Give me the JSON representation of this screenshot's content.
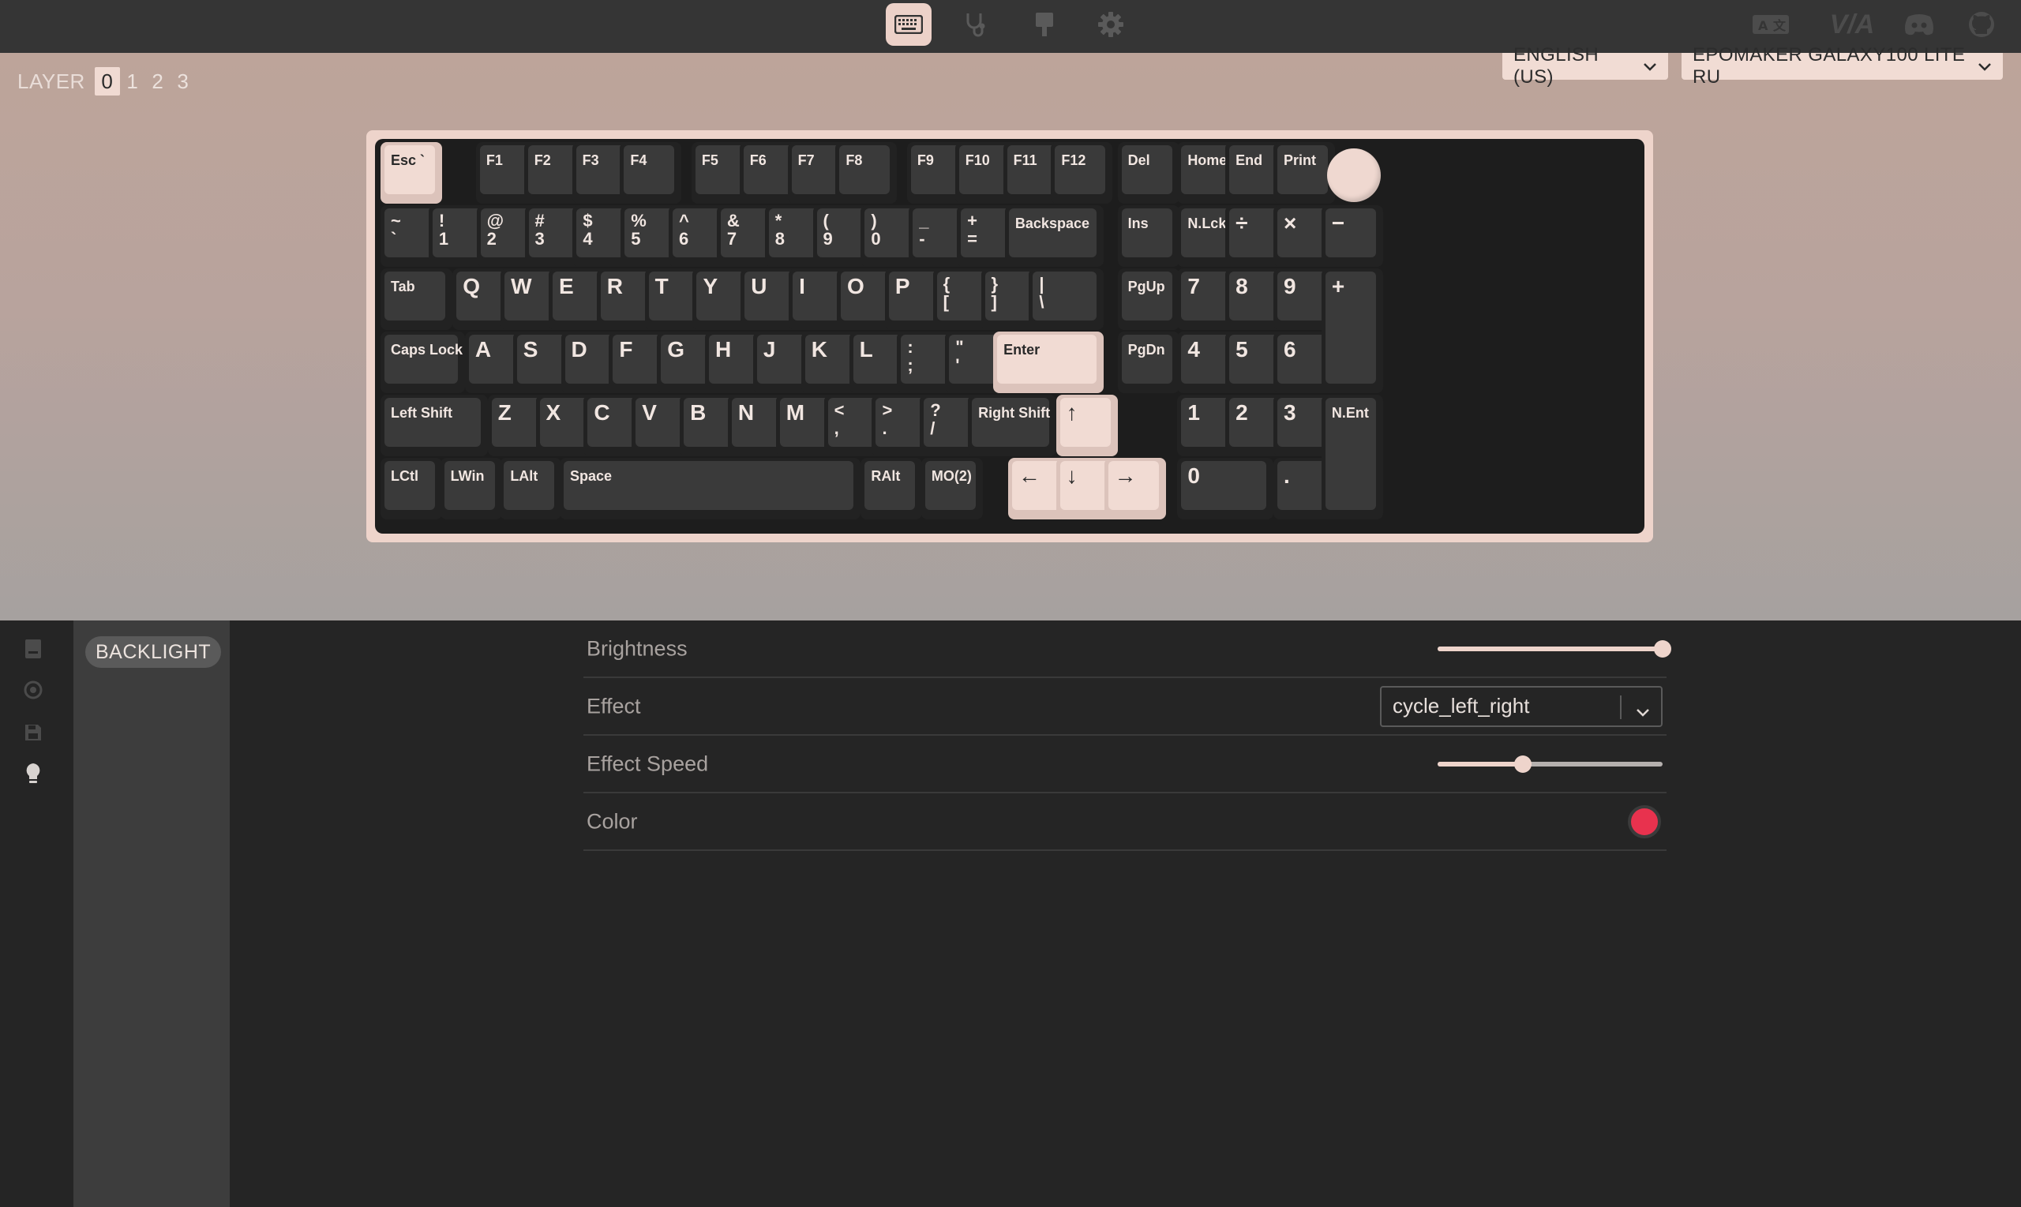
{
  "topbar": {
    "nav": [
      {
        "name": "keyboard-icon",
        "active": true
      },
      {
        "name": "stethoscope-icon",
        "active": false
      },
      {
        "name": "design-icon",
        "active": false
      },
      {
        "name": "gear-icon",
        "active": false
      }
    ],
    "external": [
      "translate-icon",
      "via-logo-icon",
      "discord-icon",
      "github-icon"
    ],
    "via_text": "V/A"
  },
  "layers": {
    "label": "LAYER",
    "items": [
      "0",
      "1",
      "2",
      "3"
    ],
    "selected": "0"
  },
  "language_dropdown": "ENGLISH (US)",
  "device_dropdown": "EPOMAKER GALAXY100 LITE RU",
  "keys": {
    "esc": "Esc `",
    "f1": "F1",
    "f2": "F2",
    "f3": "F3",
    "f4": "F4",
    "f5": "F5",
    "f6": "F6",
    "f7": "F7",
    "f8": "F8",
    "f9": "F9",
    "f10": "F10",
    "f11": "F11",
    "f12": "F12",
    "del": "Del",
    "home": "Home",
    "end": "End",
    "print": "Print",
    "grave": "~\n`",
    "n1": "!\n1",
    "n2": "@\n2",
    "n3": "#\n3",
    "n4": "$\n4",
    "n5": "%\n5",
    "n6": "^\n6",
    "n7": "&\n7",
    "n8": "*\n8",
    "n9": "(\n9",
    "n0": ")\n0",
    "minus": "_\n-",
    "equal": "+\n=",
    "backspace": "Backspace",
    "ins": "Ins",
    "nlck": "N.Lck",
    "pdiv": "÷",
    "pmul": "×",
    "pminus": "−",
    "tab": "Tab",
    "q": "Q",
    "w": "W",
    "e": "E",
    "r": "R",
    "t": "T",
    "y": "Y",
    "u": "U",
    "i": "I",
    "o": "O",
    "p": "P",
    "lbracket": "{\n[",
    "rbracket": "}\n]",
    "backslash": "|\n\\",
    "pgup": "PgUp",
    "p7": "7",
    "p8": "8",
    "p9": "9",
    "pplus": "+",
    "caps": "Caps Lock",
    "a": "A",
    "s": "S",
    "d": "D",
    "f": "F",
    "g": "G",
    "h": "H",
    "j": "J",
    "k": "K",
    "l": "L",
    "semicolon": ":\n;",
    "quote": "\"\n'",
    "enter": "Enter",
    "pgdn": "PgDn",
    "p4": "4",
    "p5": "5",
    "p6": "6",
    "lshift": "Left Shift",
    "z": "Z",
    "x": "X",
    "c": "C",
    "v": "V",
    "b": "B",
    "n": "N",
    "m": "M",
    "comma": "<\n,",
    "period": ">\n.",
    "slash": "?\n/",
    "rshift": "Right Shift",
    "up": "↑",
    "p1": "1",
    "p2": "2",
    "p3": "3",
    "pent": "N.Ent",
    "lctl": "LCtl",
    "lwin": "LWin",
    "lalt": "LAlt",
    "space": "Space",
    "ralt": "RAlt",
    "mo2": "MO(2)",
    "left": "←",
    "down": "↓",
    "right": "→",
    "p0": "0",
    "pdot": "."
  },
  "rail": [
    "keymap-icon",
    "macro-icon",
    "save-icon",
    "lightbulb-icon"
  ],
  "menu": {
    "backlight": "BACKLIGHT"
  },
  "settings": {
    "brightness": {
      "label": "Brightness",
      "value": 1.0
    },
    "effect": {
      "label": "Effect",
      "value": "cycle_left_right"
    },
    "effect_speed": {
      "label": "Effect Speed",
      "value": 0.38
    },
    "color": {
      "label": "Color",
      "value": "#e8324e"
    }
  },
  "colors": {
    "accent": "#eed4cb",
    "key_dark": "#3a3a3a",
    "key_light": "#f1dbd3"
  }
}
